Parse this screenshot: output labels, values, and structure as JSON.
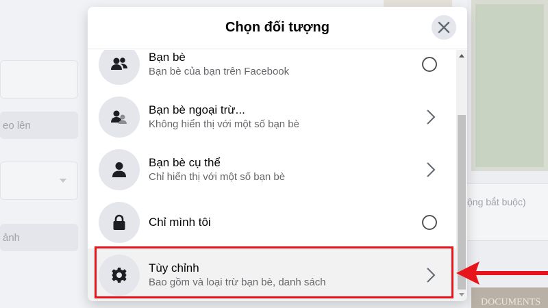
{
  "background": {
    "left_fields": [
      {
        "text": ""
      },
      {
        "text": "eo lên"
      },
      {
        "text": ""
      },
      {
        "text": "ảnh"
      }
    ],
    "right_field_text": "ộng bắt buộc)",
    "docs_text": "DOCUMENTS"
  },
  "modal": {
    "title": "Chọn đối tượng",
    "items": [
      {
        "label": "Bạn bè",
        "sub": "Bạn bè của bạn trên Facebook",
        "icon": "friends-icon",
        "control": "radio"
      },
      {
        "label": "Bạn bè ngoại trừ...",
        "sub": "Không hiển thị với một số bạn bè",
        "icon": "friends-except-icon",
        "control": "chevron"
      },
      {
        "label": "Bạn bè cụ thể",
        "sub": "Chỉ hiển thị với một số bạn bè",
        "icon": "person-icon",
        "control": "chevron"
      },
      {
        "label": "Chỉ mình tôi",
        "sub": "",
        "icon": "lock-icon",
        "control": "radio"
      },
      {
        "label": "Tùy chỉnh",
        "sub": "Bao gồm và loại trừ bạn bè, danh sách",
        "icon": "gear-icon",
        "control": "chevron"
      }
    ]
  },
  "colors": {
    "annotation_red": "#e8141b",
    "text_primary": "#050505",
    "text_secondary": "#65676b",
    "icon_bg": "#e4e6eb"
  }
}
